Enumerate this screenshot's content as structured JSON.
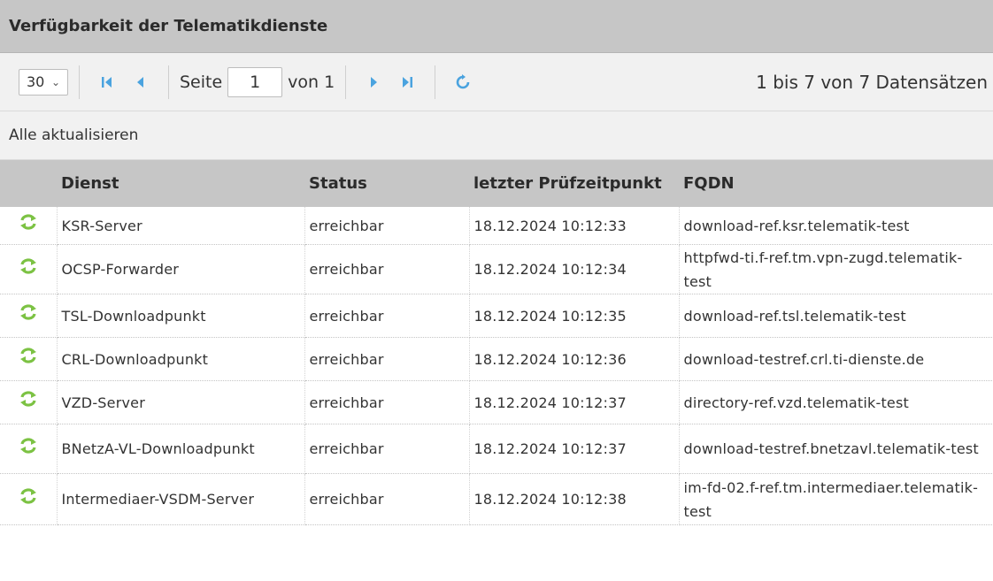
{
  "panel": {
    "title": "Verfügbarkeit der Telematikdienste"
  },
  "toolbar": {
    "page_size": "30",
    "page_label": "Seite",
    "page_value": "1",
    "of_label": "von 1",
    "record_count": "1 bis 7 von 7 Datensätzen"
  },
  "actions": {
    "refresh_all": "Alle aktualisieren"
  },
  "table": {
    "headers": [
      "Dienst",
      "Status",
      "letzter Prüfzeitpunkt",
      "FQDN"
    ],
    "rows": [
      {
        "dienst": "KSR-Server",
        "status": "erreichbar",
        "zeit": "18.12.2024 10:12:33",
        "fqdn": "download-ref.ksr.telematik-test"
      },
      {
        "dienst": "OCSP-Forwarder",
        "status": "erreichbar",
        "zeit": "18.12.2024 10:12:34",
        "fqdn": "httpfwd-ti.f-ref.tm.vpn-zugd.telematik-test"
      },
      {
        "dienst": "TSL-Downloadpunkt",
        "status": "erreichbar",
        "zeit": "18.12.2024 10:12:35",
        "fqdn": "download-ref.tsl.telematik-test"
      },
      {
        "dienst": "CRL-Downloadpunkt",
        "status": "erreichbar",
        "zeit": "18.12.2024 10:12:36",
        "fqdn": "download-testref.crl.ti-dienste.de"
      },
      {
        "dienst": "VZD-Server",
        "status": "erreichbar",
        "zeit": "18.12.2024 10:12:37",
        "fqdn": "directory-ref.vzd.telematik-test"
      },
      {
        "dienst": "BNetzA-VL-Downloadpunkt",
        "status": "erreichbar",
        "zeit": "18.12.2024 10:12:37",
        "fqdn": "download-testref.bnetzavl.telematik-test"
      },
      {
        "dienst": "Intermediaer-VSDM-Server",
        "status": "erreichbar",
        "zeit": "18.12.2024 10:12:38",
        "fqdn": "im-fd-02.f-ref.tm.intermediaer.telematik-test"
      }
    ]
  },
  "colors": {
    "header_bg": "#c6c6c6",
    "toolbar_bg": "#f1f1f1",
    "nav_icon": "#4aa3df",
    "refresh_icon": "#7cc243"
  }
}
